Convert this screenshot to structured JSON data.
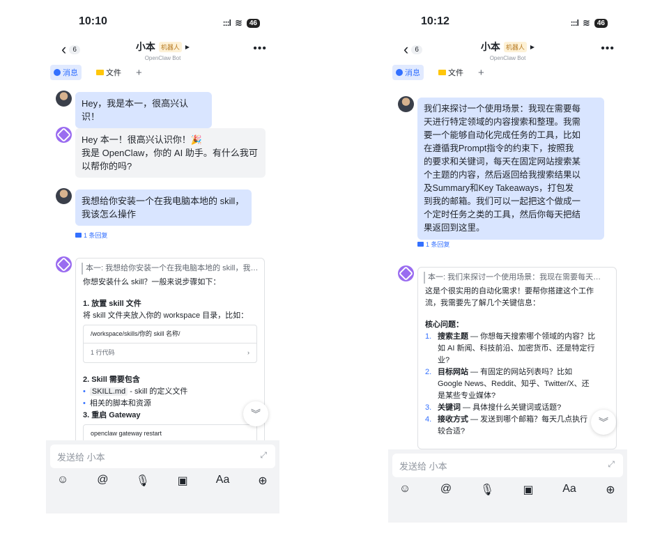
{
  "left": {
    "status": {
      "time": "10:10",
      "signal": ":::l",
      "wifi": "≋",
      "battery": "46"
    },
    "nav": {
      "back_count": "6",
      "title": "小本",
      "badge": "机器人",
      "subtitle": "OpenClaw Bot"
    },
    "tabs": {
      "messages": "消息",
      "files": "文件",
      "add": "+"
    },
    "messages": [
      {
        "text": "Hey，我是本一，很高兴认识！"
      },
      {
        "line1": "Hey 本一！很高兴认识你！🎉",
        "line2": "我是 OpenClaw，你的 AI 助手。有什么我可",
        "line3": "以帮你的吗?"
      },
      {
        "line1": "我想给你安装一个在我电脑本地的 skill，",
        "line2": "我该怎么操作"
      }
    ],
    "reply_count": "1 条回复",
    "card": {
      "quote": "本一: 我想给你安装一个在我电脑本地的 skill，我…",
      "intro": "你想安装什么 skill？一般来说步骤如下：",
      "h1": "1. 放置 skill 文件",
      "p1": "将 skill 文件夹放入你的 workspace 目录，比如：",
      "code1": "/workspace/skills/你的 skill 名称/",
      "code1_foot": "1 行代码",
      "h2": "2. Skill 需要包含",
      "b1_code": "SKILL.md",
      "b1_rest": " - skill 的定义文件",
      "b2": "相关的脚本和资源",
      "h3": "3. 重启 Gateway",
      "code2": "openclaw gateway restart"
    },
    "composer": {
      "placeholder": "发送给 小本"
    }
  },
  "right": {
    "status": {
      "time": "10:12",
      "signal": ":::l",
      "wifi": "≋",
      "battery": "46"
    },
    "nav": {
      "back_count": "6",
      "title": "小本",
      "badge": "机器人",
      "subtitle": "OpenClaw Bot"
    },
    "tabs": {
      "messages": "消息",
      "files": "文件",
      "add": "+"
    },
    "message": {
      "lines": [
        "我们来探讨一个使用场景：我现在需要每",
        "天进行特定领域的内容搜索和整理。我需",
        "要一个能够自动化完成任务的工具，比如",
        "在遵循我Prompt指令的约束下，按照我",
        "的要求和关键词，每天在固定网站搜索某",
        "个主题的内容，然后返回给我搜索结果以",
        "及Summary和Key Takeaways，打包发",
        "到我的邮箱。我们可以一起把这个做成一",
        "个定时任务之类的工具，然后你每天把结",
        "果返回到这里。"
      ]
    },
    "reply_count": "1 条回复",
    "card": {
      "quote": "本一: 我们来探讨一个使用场景：我现在需要每天…",
      "intro1": "这是个很实用的自动化需求！要帮你搭建这个工作",
      "intro2": "流，我需要先了解几个关键信息：",
      "heading": "核心问题：",
      "items": [
        {
          "n": "1.",
          "label": "搜索主题",
          "l1": " — 你想每天搜索哪个领域的内容？比",
          "l2": "如 AI 新闻、科技前沿、加密货币、还是特定行",
          "l3": "业?"
        },
        {
          "n": "2.",
          "label": "目标网站",
          "l1": " — 有固定的网站列表吗？比如",
          "l2": "Google News、Reddit、知乎、Twitter/X、还",
          "l3": "是某些专业媒体?"
        },
        {
          "n": "3.",
          "label": "关键词",
          "l1": " — 具体搜什么关键词或话题?",
          "l2": "",
          "l3": ""
        },
        {
          "n": "4.",
          "label": "接收方式",
          "l1": " — 发送到哪个邮箱？每天几点执行",
          "l2": "较合适?",
          "l3": ""
        }
      ]
    },
    "composer": {
      "placeholder": "发送给 小本"
    }
  },
  "toolbar_icons": [
    "emoji-icon",
    "mention-icon",
    "microphone-icon",
    "image-icon",
    "text-format-icon",
    "add-circle-icon"
  ],
  "toolbar_glyphs": {
    "emoji": "☺",
    "mention": "@",
    "mic": "🎙",
    "image": "▣",
    "format": "Aa",
    "add": "⊕"
  },
  "colors": {
    "accent": "#3370ff",
    "user_bubble": "#d9e5ff",
    "bot_bubble": "#f2f3f5",
    "bot_avatar": "#9a6cf0"
  }
}
